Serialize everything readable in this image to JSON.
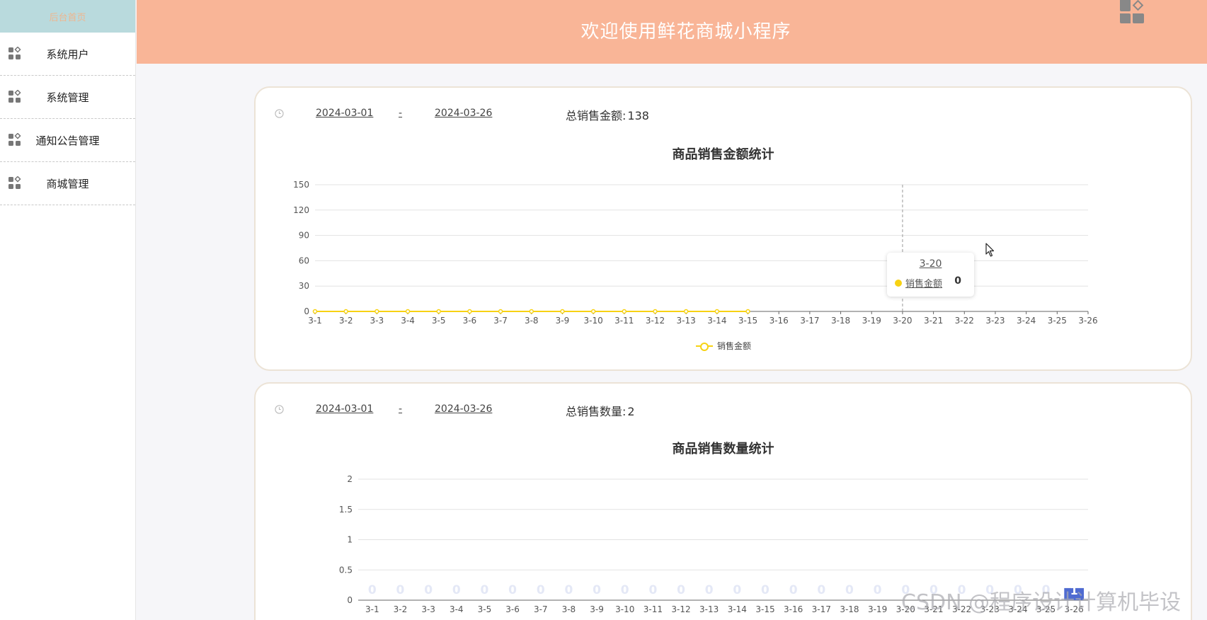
{
  "sidebar": {
    "home": "后台首页",
    "items": [
      {
        "label": "系统用户"
      },
      {
        "label": "系统管理"
      },
      {
        "label": "通知公告管理"
      },
      {
        "label": "商城管理"
      }
    ]
  },
  "header": {
    "title": "欢迎使用鲜花商城小程序"
  },
  "sales_amount": {
    "start_date": "2024-03-01",
    "separator": "-",
    "end_date": "2024-03-26",
    "total_label": "总销售金额:",
    "total_value": "138",
    "tooltip": {
      "category": "3-20",
      "series": "销售金额",
      "value": "0"
    },
    "legend": "销售金额"
  },
  "sales_qty": {
    "start_date": "2024-03-01",
    "separator": "-",
    "end_date": "2024-03-26",
    "total_label": "总销售数量:",
    "total_value": "2"
  },
  "chart_data": [
    {
      "type": "line",
      "title": "商品销售金额统计",
      "categories": [
        "3-1",
        "3-2",
        "3-3",
        "3-4",
        "3-5",
        "3-6",
        "3-7",
        "3-8",
        "3-9",
        "3-10",
        "3-11",
        "3-12",
        "3-13",
        "3-14",
        "3-15",
        "3-16",
        "3-17",
        "3-18",
        "3-19",
        "3-20",
        "3-21",
        "3-22",
        "3-23",
        "3-24",
        "3-25",
        "3-26"
      ],
      "yticks": [
        0,
        30,
        60,
        90,
        120,
        150
      ],
      "ylim": [
        0,
        150
      ],
      "series": [
        {
          "name": "销售金额",
          "color": "#f7d213",
          "values": [
            0,
            0,
            0,
            0,
            0,
            0,
            0,
            0,
            0,
            0,
            0,
            0,
            0,
            0,
            0
          ]
        }
      ],
      "legend": "bottom-center",
      "grid": true
    },
    {
      "type": "bar",
      "title": "商品销售数量统计",
      "categories": [
        "3-1",
        "3-2",
        "3-3",
        "3-4",
        "3-5",
        "3-6",
        "3-7",
        "3-8",
        "3-9",
        "3-10",
        "3-11",
        "3-12",
        "3-13",
        "3-14",
        "3-15",
        "3-16",
        "3-17",
        "3-18",
        "3-19",
        "3-20",
        "3-21",
        "3-22",
        "3-23",
        "3-24",
        "3-25",
        "3-26"
      ],
      "yticks": [
        "0",
        "0.5",
        "1",
        "1.5",
        "2"
      ],
      "ylim": [
        0,
        2
      ],
      "values": [
        0,
        0,
        0,
        0,
        0,
        0,
        0,
        0,
        0,
        0,
        0,
        0,
        0,
        0,
        0,
        0,
        0,
        0,
        0,
        0,
        0,
        0,
        0,
        0,
        0,
        0.2
      ],
      "labels": [
        "0",
        "0",
        "0",
        "0",
        "0",
        "0",
        "0",
        "0",
        "0",
        "0",
        "0",
        "0",
        "0",
        "0",
        "0",
        "0",
        "0",
        "0",
        "0",
        "0",
        "0",
        "0",
        "0",
        "0",
        "0",
        "1"
      ],
      "color": "#4f6bd1",
      "grid": true
    }
  ],
  "watermark": "CSDN @程序设计计算机毕设"
}
